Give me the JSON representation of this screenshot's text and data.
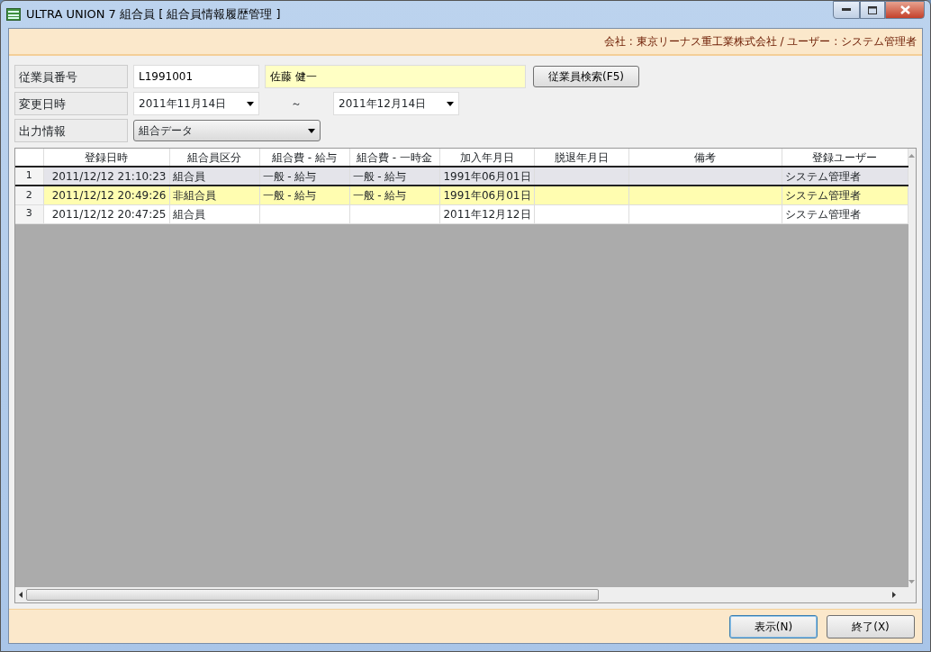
{
  "window": {
    "title": "ULTRA UNION 7 組合員 [ 組合員情報履歴管理 ]"
  },
  "info_bar": {
    "text": "会社 : 東京リーナス重工業株式会社 / ユーザー : システム管理者"
  },
  "form": {
    "employee_no": {
      "label": "従業員番号",
      "value": "L1991001"
    },
    "employee_name": {
      "value": "佐藤 健一"
    },
    "search_button": "従業員検索(F5)",
    "changed_at": {
      "label": "変更日時",
      "from": "2011年11月14日",
      "separator": "～",
      "to": "2011年12月14日"
    },
    "output": {
      "label": "出力情報",
      "value": "組合データ"
    }
  },
  "table": {
    "columns": [
      "登録日時",
      "組合員区分",
      "組合費 - 給与",
      "組合費 - 一時金",
      "加入年月日",
      "脱退年月日",
      "備考",
      "登録ユーザー"
    ],
    "rows": [
      {
        "number": "1",
        "selected": true,
        "highlighted": false,
        "cells": [
          "2011/12/12 21:10:23",
          "組合員",
          "一般 - 給与",
          "一般 - 給与",
          "1991年06月01日",
          "",
          "",
          "システム管理者"
        ]
      },
      {
        "number": "2",
        "selected": false,
        "highlighted": true,
        "cells": [
          "2011/12/12 20:49:26",
          "非組合員",
          "一般 - 給与",
          "一般 - 給与",
          "1991年06月01日",
          "",
          "",
          "システム管理者"
        ]
      },
      {
        "number": "3",
        "selected": false,
        "highlighted": false,
        "cells": [
          "2011/12/12 20:47:25",
          "組合員",
          "",
          "",
          "2011年12月12日",
          "",
          "",
          "システム管理者"
        ]
      }
    ]
  },
  "buttons": [
    {
      "label": "表示(N)",
      "default": true
    },
    {
      "label": "終了(X)",
      "default": false
    }
  ]
}
